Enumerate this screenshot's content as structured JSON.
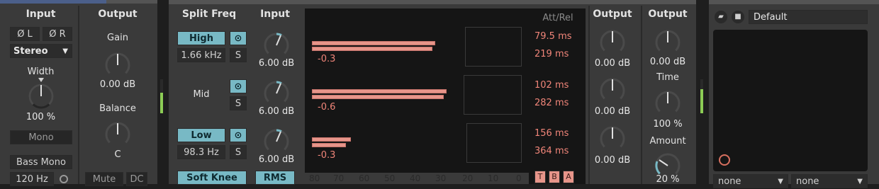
{
  "utility": {
    "input_label": "Input",
    "phase_l": "Ø L",
    "phase_r": "Ø R",
    "channel_mode": "Stereo",
    "width_label": "Width",
    "width_value": "100 %",
    "mono_label": "Mono",
    "bass_mono_label": "Bass Mono",
    "bass_mono_freq": "120 Hz",
    "output_label": "Output",
    "gain_label": "Gain",
    "gain_value": "0.00 dB",
    "balance_label": "Balance",
    "balance_value": "C",
    "mute_label": "Mute",
    "dc_label": "DC"
  },
  "multiband": {
    "split_freq_label": "Split Freq",
    "input_label": "Input",
    "high_label": "High",
    "high_freq": "1.66 kHz",
    "mid_label": "Mid",
    "low_label": "Low",
    "low_freq": "98.3 Hz",
    "solo_label": "S",
    "soft_knee_label": "Soft Knee",
    "rms_label": "RMS",
    "input_gains": [
      "6.00 dB",
      "6.00 dB",
      "6.00 dB"
    ],
    "band_readouts": [
      "-0.3",
      "-0.6",
      "-0.3"
    ],
    "att_rel_label": "Att/Rel",
    "attack_release": [
      {
        "attack": "79.5 ms",
        "release": "219 ms"
      },
      {
        "attack": "102 ms",
        "release": "282 ms"
      },
      {
        "attack": "156 ms",
        "release": "364 ms"
      }
    ],
    "scale_labels": [
      "80",
      "70",
      "60",
      "50",
      "40",
      "30",
      "20",
      "10",
      "0"
    ],
    "band_output_label": "Output",
    "band_outputs": [
      "0.00 dB",
      "0.00 dB",
      "0.00 dB"
    ],
    "mode_buttons": [
      "T",
      "B",
      "A"
    ],
    "output_label": "Output",
    "output_value": "0.00 dB",
    "time_label": "Time",
    "time_value": "100 %",
    "amount_label": "Amount",
    "amount_value": "20 %",
    "band_levels": [
      {
        "top": 0.44,
        "bottom": 0.43
      },
      {
        "top": 0.48,
        "bottom": 0.47
      },
      {
        "top": 0.14,
        "bottom": 0.12
      }
    ]
  },
  "rack": {
    "preset_name": "Default",
    "dropdown_a": "none",
    "dropdown_b": "none"
  },
  "colors": {
    "accent": "#78b9c5",
    "band_bar": "#e7958a",
    "att_rel_text": "#f08579",
    "meter_green": "#8ccc55"
  }
}
